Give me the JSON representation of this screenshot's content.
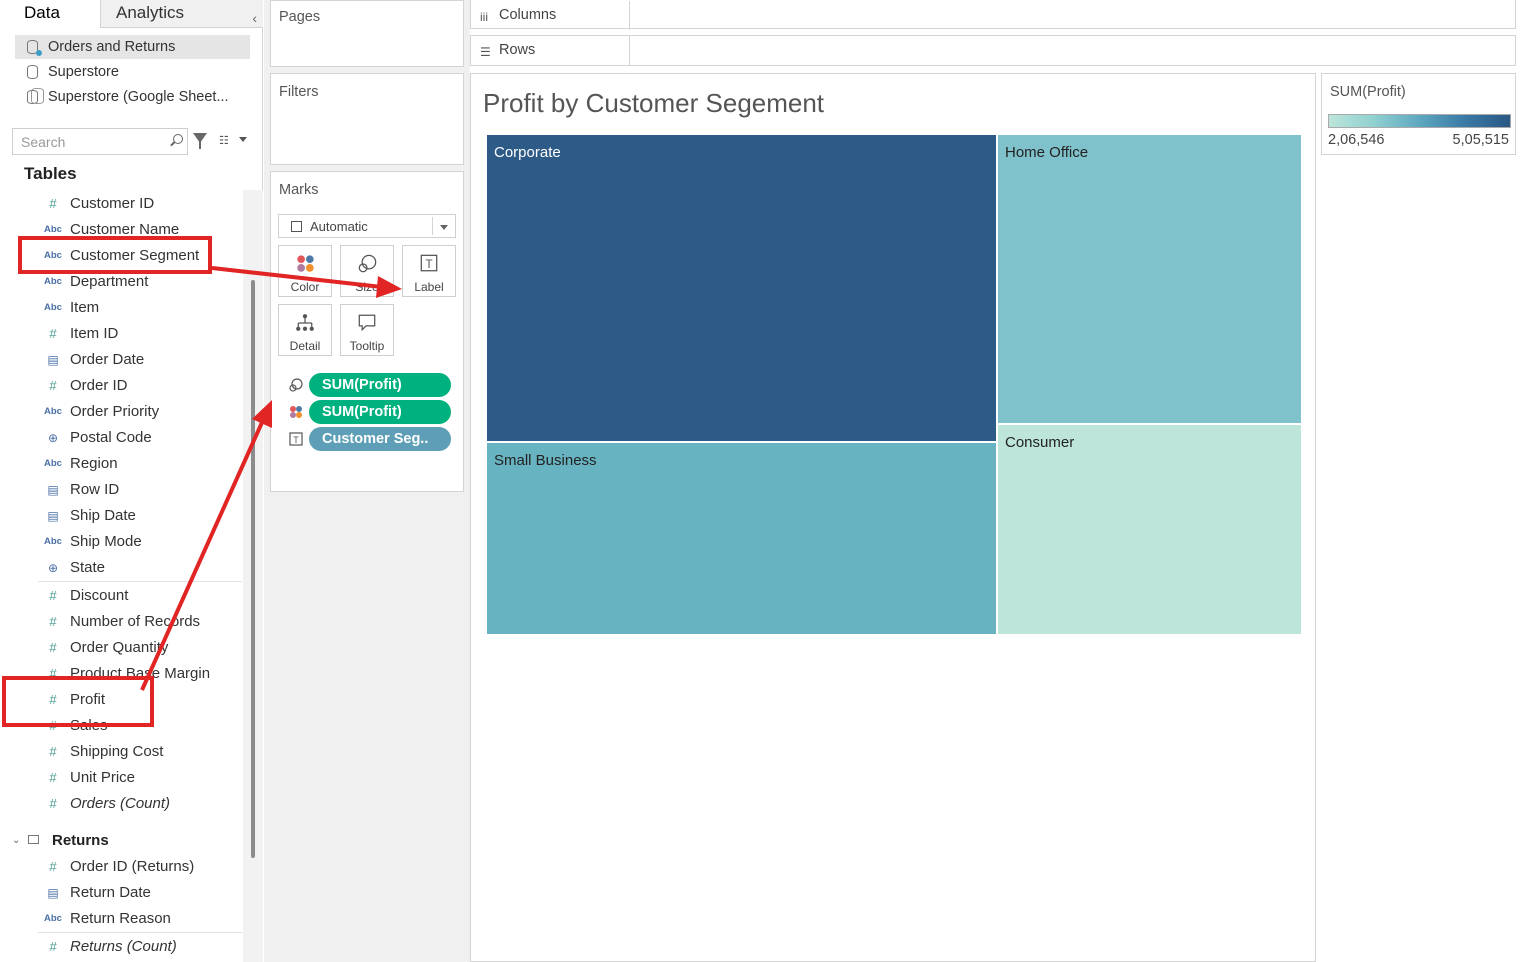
{
  "tabs": {
    "data": "Data",
    "analytics": "Analytics"
  },
  "datasources": [
    "Orders and Returns",
    "Superstore",
    "Superstore (Google Sheet..."
  ],
  "search": {
    "placeholder": "Search"
  },
  "tables_heading": "Tables",
  "fields": [
    {
      "name": "Customer ID",
      "type": "number"
    },
    {
      "name": "Customer Name",
      "type": "abc"
    },
    {
      "name": "Customer Segment",
      "type": "abc"
    },
    {
      "name": "Department",
      "type": "abc"
    },
    {
      "name": "Item",
      "type": "abc"
    },
    {
      "name": "Item ID",
      "type": "number"
    },
    {
      "name": "Order Date",
      "type": "date"
    },
    {
      "name": "Order ID",
      "type": "number"
    },
    {
      "name": "Order Priority",
      "type": "abc"
    },
    {
      "name": "Postal Code",
      "type": "geo"
    },
    {
      "name": "Region",
      "type": "abc"
    },
    {
      "name": "Row ID",
      "type": "date"
    },
    {
      "name": "Ship Date",
      "type": "date"
    },
    {
      "name": "Ship Mode",
      "type": "abc"
    },
    {
      "name": "State",
      "type": "geo"
    }
  ],
  "measures": [
    {
      "name": "Discount"
    },
    {
      "name": "Number of Records"
    },
    {
      "name": "Order Quantity"
    },
    {
      "name": "Product Base Margin"
    },
    {
      "name": "Profit"
    },
    {
      "name": "Sales"
    },
    {
      "name": "Shipping Cost"
    },
    {
      "name": "Unit Price"
    },
    {
      "name": "Orders (Count)"
    }
  ],
  "returns_table": {
    "title": "Returns",
    "fields": [
      {
        "name": "Order ID (Returns)",
        "type": "number"
      },
      {
        "name": "Return Date",
        "type": "date"
      },
      {
        "name": "Return Reason",
        "type": "abc"
      },
      {
        "name": "Returns (Count)",
        "type": "number"
      }
    ]
  },
  "shelves": {
    "pages": "Pages",
    "filters": "Filters",
    "marks": "Marks",
    "columns": "Columns",
    "rows": "Rows"
  },
  "marks": {
    "type": "Automatic",
    "buttons": [
      "Color",
      "Size",
      "Label",
      "Detail",
      "Tooltip"
    ],
    "pills": [
      "SUM(Profit)",
      "SUM(Profit)",
      "Customer Seg.."
    ]
  },
  "viz": {
    "title": "Profit by Customer Segement"
  },
  "chart_data": {
    "type": "treemap",
    "title": "Profit by Customer Segement",
    "measure": "SUM(Profit)",
    "segments": [
      {
        "label": "Corporate",
        "color": "#2e5a87"
      },
      {
        "label": "Home Office",
        "color": "#80c2cb"
      },
      {
        "label": "Small Business",
        "color": "#68b3c1"
      },
      {
        "label": "Consumer",
        "color": "#bde5da"
      }
    ]
  },
  "legend": {
    "title": "SUM(Profit)",
    "min": "2,06,546",
    "max": "5,05,515"
  }
}
